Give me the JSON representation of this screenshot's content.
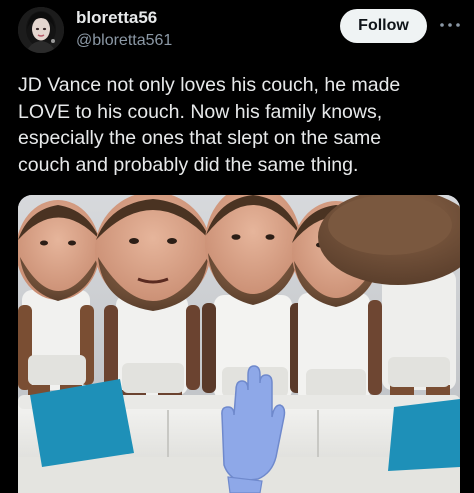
{
  "author": {
    "display_name": "bloretta56",
    "handle": "@bloretta561",
    "avatar_icon": "avatar-portrait"
  },
  "actions": {
    "follow_label": "Follow",
    "more_icon": "more-horizontal-icon"
  },
  "tweet": {
    "text": "JD Vance not only loves his couch, he made\nLOVE to his couch. Now his family knows,\nespecially the ones that slept on the same\ncouch and probably did the same thing."
  },
  "media": {
    "type": "photo"
  },
  "colors": {
    "background": "#000000",
    "text": "#e7e9ea",
    "secondary_text": "#8b98a5",
    "follow_bg": "#eff3f4",
    "follow_text": "#0f1419",
    "pillow": "#1e90b8",
    "glove": "#8ea8e8"
  }
}
